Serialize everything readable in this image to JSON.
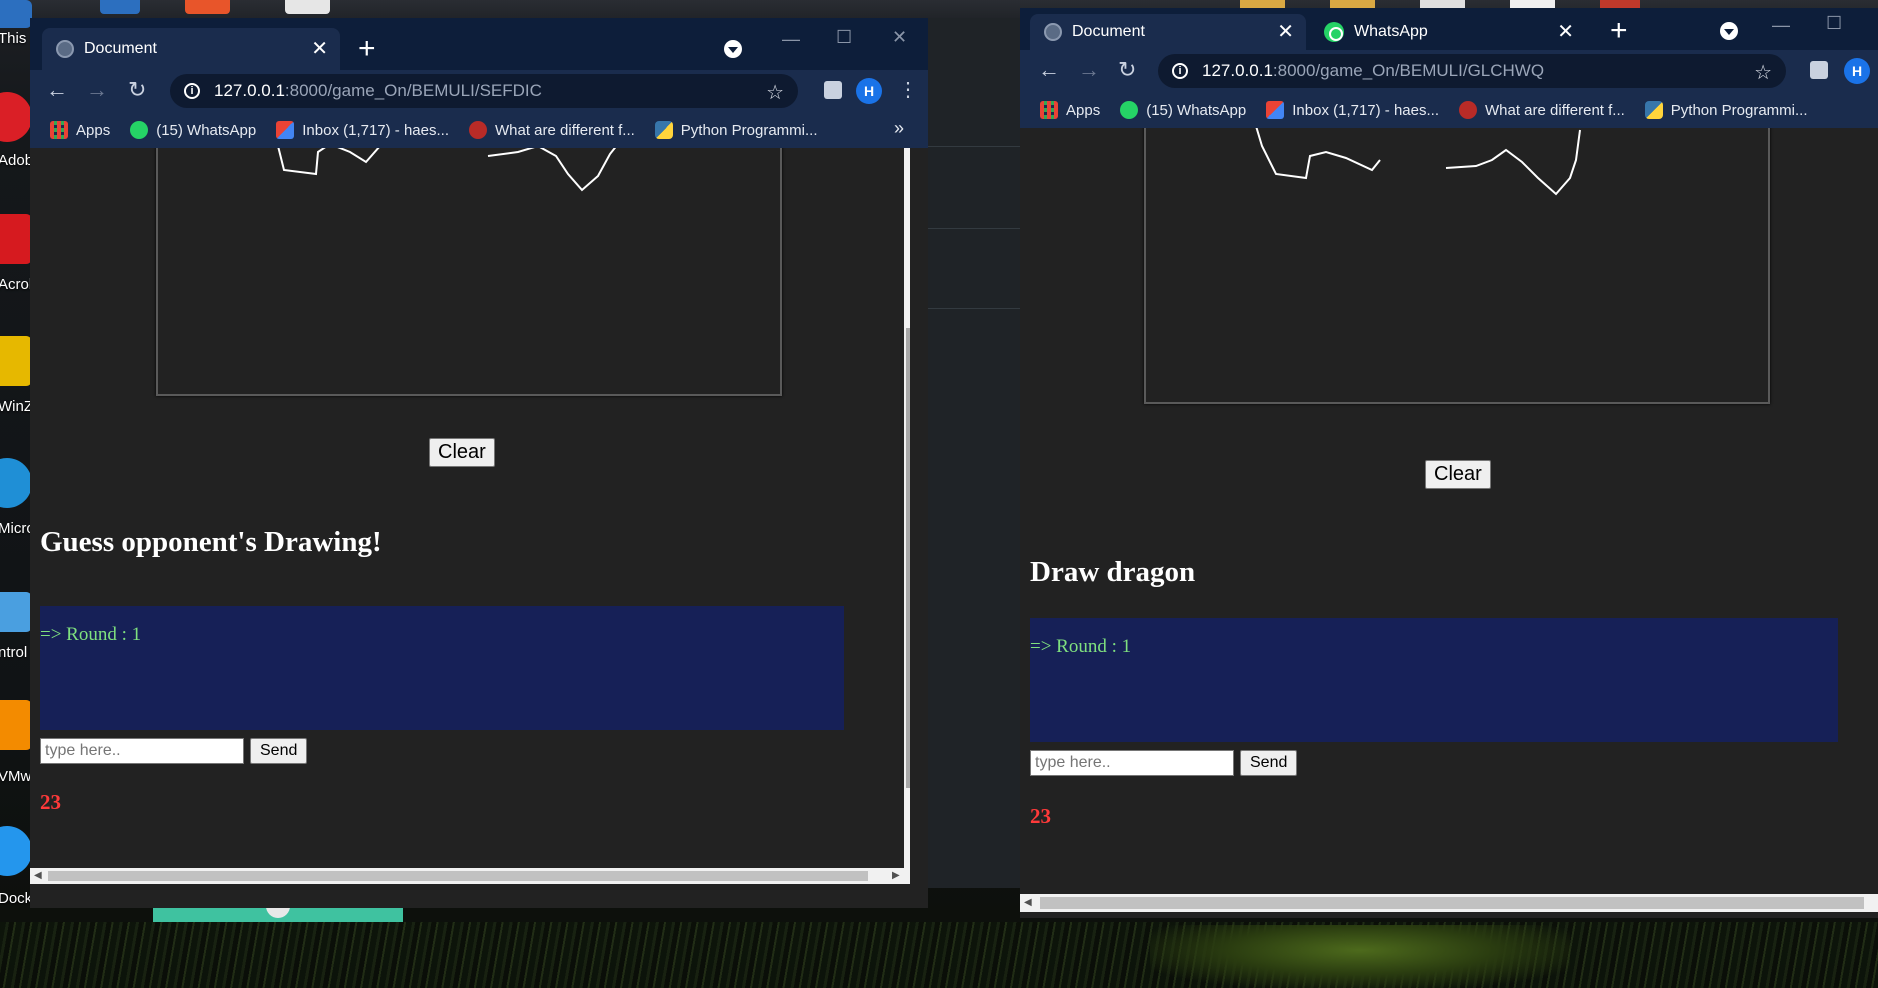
{
  "desktop": {
    "icons": [
      {
        "label": "This PC Shortc",
        "icon": "this-pc-icon",
        "color": "#2c6fbf"
      },
      {
        "label": "Adobe Creat",
        "icon": "adobe-cc-icon",
        "color": "#da1f26"
      },
      {
        "label": "Acrob Reade",
        "icon": "acrobat-reader-icon",
        "color": "#d61a1f"
      },
      {
        "label": "WinZ",
        "icon": "winzip-icon",
        "color": "#e6b800"
      },
      {
        "label": "Micros Edg",
        "icon": "edge-icon",
        "color": "#1f8fd6"
      },
      {
        "label": "ntrol",
        "icon": "control-panel-icon",
        "color": "#4a9fe0"
      },
      {
        "label": "VMwa Workst",
        "icon": "vmware-icon",
        "color": "#f38b00"
      },
      {
        "label": "Dock Desktop",
        "icon": "docker-icon",
        "color": "#2496ed"
      }
    ]
  },
  "windows": [
    {
      "tabs": [
        {
          "title": "Document",
          "icon": "globe-icon",
          "active": true
        }
      ],
      "url_host": "127.0.0.1",
      "url_path": ":8000/game_On/BEMULI/SEFDIC",
      "bookmarks": [
        "Apps",
        "(15) WhatsApp",
        "Inbox (1,717) - haes...",
        "What are different f...",
        "Python Programmi..."
      ],
      "more_bookmarks": "»",
      "avatar": "H",
      "clear_label": "Clear",
      "heading": "Guess opponent's Drawing!",
      "chat_lines": [
        "=> Round : 1"
      ],
      "input_placeholder": "type here..",
      "send_label": "Send",
      "timer": "23"
    },
    {
      "tabs": [
        {
          "title": "Document",
          "icon": "globe-icon",
          "active": true
        },
        {
          "title": "WhatsApp",
          "icon": "whatsapp-icon",
          "active": false
        }
      ],
      "url_host": "127.0.0.1",
      "url_path": ":8000/game_On/BEMULI/GLCHWQ",
      "bookmarks": [
        "Apps",
        "(15) WhatsApp",
        "Inbox (1,717) - haes...",
        "What are different f...",
        "Python Programmi..."
      ],
      "avatar": "H",
      "clear_label": "Clear",
      "heading": "Draw dragon",
      "chat_lines": [
        "=> Round : 1"
      ],
      "input_placeholder": "type here..",
      "send_label": "Send",
      "timer": "23"
    }
  ],
  "colors": {
    "chrome_frame": "#0d1e3a",
    "chrome_toolbar": "#1a2c4d",
    "page_bg": "#222222",
    "chat_bg": "#162057",
    "chat_text": "#7fe07f",
    "timer": "#ff3a3a"
  }
}
